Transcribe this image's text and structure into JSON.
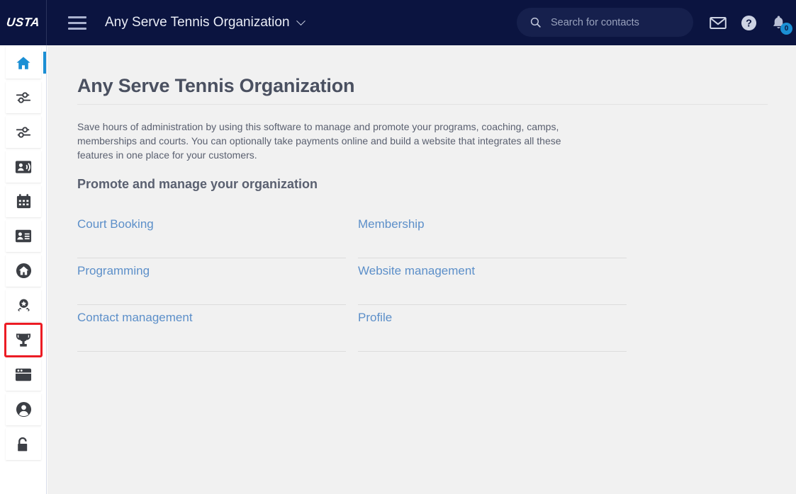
{
  "header": {
    "logo_text": "USTA",
    "menu_icon": "hamburger-menu-icon",
    "org_name": "Any Serve Tennis Organization",
    "chevron_icon": "chevron-down-icon",
    "search": {
      "icon": "search-icon",
      "placeholder": "Search for contacts",
      "value": ""
    },
    "icons": [
      {
        "name": "mail-icon",
        "label": "Messages"
      },
      {
        "name": "help-icon",
        "label": "Help"
      },
      {
        "name": "bell-icon",
        "label": "Notifications"
      }
    ],
    "notification_count": "0",
    "colors": {
      "header_bg": "#0b1440",
      "search_bg": "#16204d",
      "accent_blue": "#1b8fd4",
      "badge_bg": "#1b8fd4"
    }
  },
  "sidebar": {
    "items": [
      {
        "name": "sidebar-item-home",
        "icon": "home-icon",
        "active": true,
        "highlighted": false
      },
      {
        "name": "sidebar-item-settings-1",
        "icon": "sliders-icon",
        "active": false,
        "highlighted": false
      },
      {
        "name": "sidebar-item-settings-2",
        "icon": "sliders-icon",
        "active": false,
        "highlighted": false
      },
      {
        "name": "sidebar-item-contact-call",
        "icon": "contact-phone-icon",
        "active": false,
        "highlighted": false
      },
      {
        "name": "sidebar-item-calendar",
        "icon": "calendar-icon",
        "active": false,
        "highlighted": false
      },
      {
        "name": "sidebar-item-contact-card",
        "icon": "id-card-icon",
        "active": false,
        "highlighted": false
      },
      {
        "name": "sidebar-item-facility",
        "icon": "home-circle-icon",
        "active": false,
        "highlighted": false
      },
      {
        "name": "sidebar-item-awards",
        "icon": "award-medal-icon",
        "active": false,
        "highlighted": false
      },
      {
        "name": "sidebar-item-tournaments",
        "icon": "trophy-icon",
        "active": false,
        "highlighted": true
      },
      {
        "name": "sidebar-item-website",
        "icon": "browser-window-icon",
        "active": false,
        "highlighted": false
      },
      {
        "name": "sidebar-item-profile",
        "icon": "user-circle-icon",
        "active": false,
        "highlighted": false
      },
      {
        "name": "sidebar-item-permissions",
        "icon": "unlock-padlock-icon",
        "active": false,
        "highlighted": false
      }
    ],
    "highlight_color": "#ec1c24",
    "active_color": "#1b8fd4"
  },
  "main": {
    "page_title": "Any Serve Tennis Organization",
    "intro": "Save hours of administration by using this software to manage and promote your programs, coaching, camps, memberships and courts. You can optionally take payments online and build a website that integrates all these features in one place for your customers.",
    "section_heading": "Promote and manage your organization",
    "links": [
      {
        "label": "Court Booking",
        "name": "link-court-booking"
      },
      {
        "label": "Membership",
        "name": "link-membership"
      },
      {
        "label": "Programming",
        "name": "link-programming"
      },
      {
        "label": "Website management",
        "name": "link-website-management"
      },
      {
        "label": "Contact management",
        "name": "link-contact-management"
      },
      {
        "label": "Profile",
        "name": "link-profile"
      }
    ],
    "link_color": "#5c8fc9",
    "background": "#f1f1f1"
  }
}
